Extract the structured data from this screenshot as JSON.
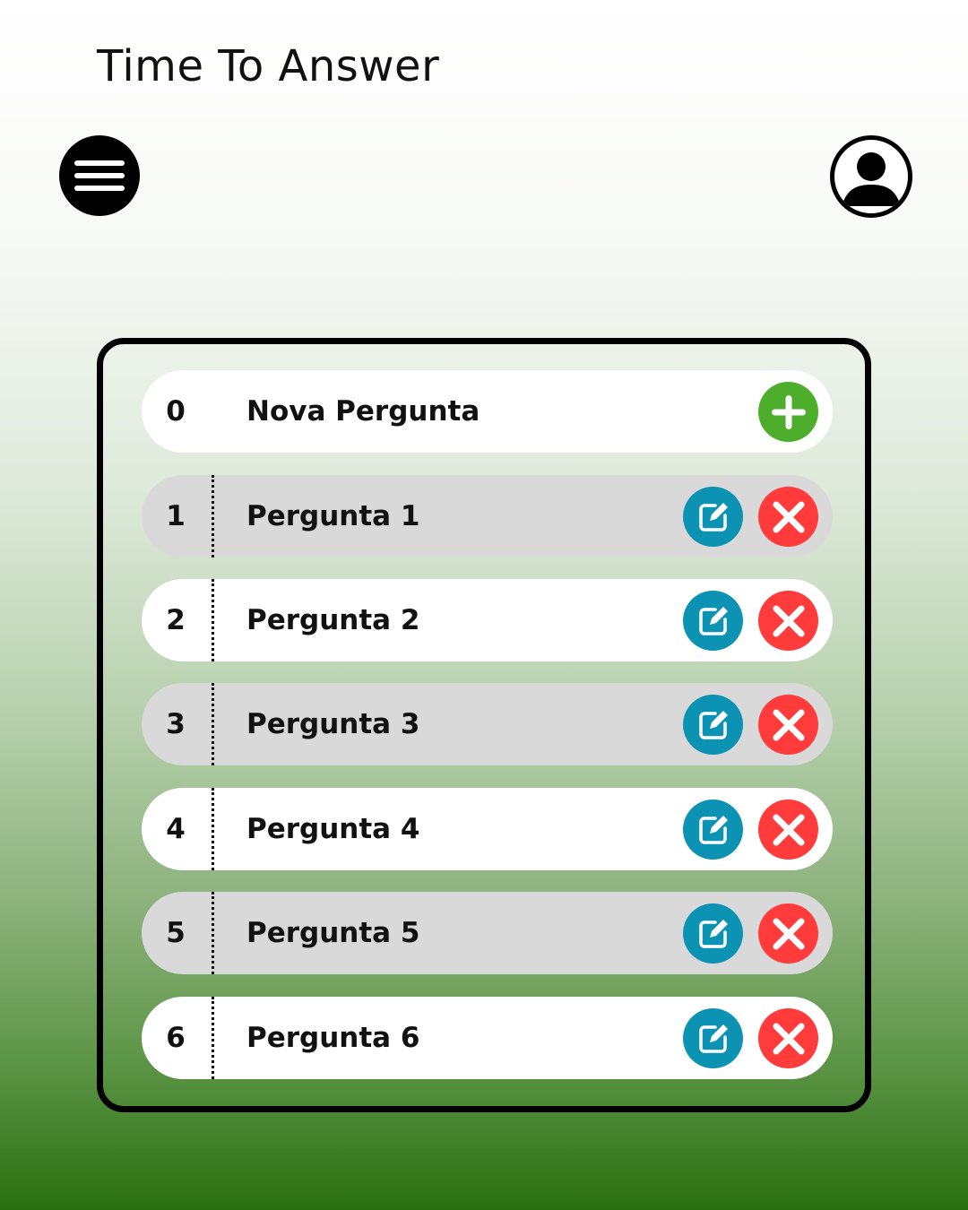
{
  "header": {
    "title": "Time To Answer",
    "menu_icon": "hamburger-menu-icon",
    "profile_icon": "user-profile-icon"
  },
  "colors": {
    "add": "#4cae2b",
    "edit": "#0c93b4",
    "delete": "#ff3b3b",
    "row_alt": "#d9d9d9"
  },
  "questions": [
    {
      "num": "0",
      "label": "Nova Pergunta",
      "action": "add"
    },
    {
      "num": "1",
      "label": "Pergunta 1",
      "action": "edit-delete"
    },
    {
      "num": "2",
      "label": "Pergunta 2",
      "action": "edit-delete"
    },
    {
      "num": "3",
      "label": "Pergunta 3",
      "action": "edit-delete"
    },
    {
      "num": "4",
      "label": "Pergunta 4",
      "action": "edit-delete"
    },
    {
      "num": "5",
      "label": "Pergunta 5",
      "action": "edit-delete"
    },
    {
      "num": "6",
      "label": "Pergunta 6",
      "action": "edit-delete"
    }
  ]
}
